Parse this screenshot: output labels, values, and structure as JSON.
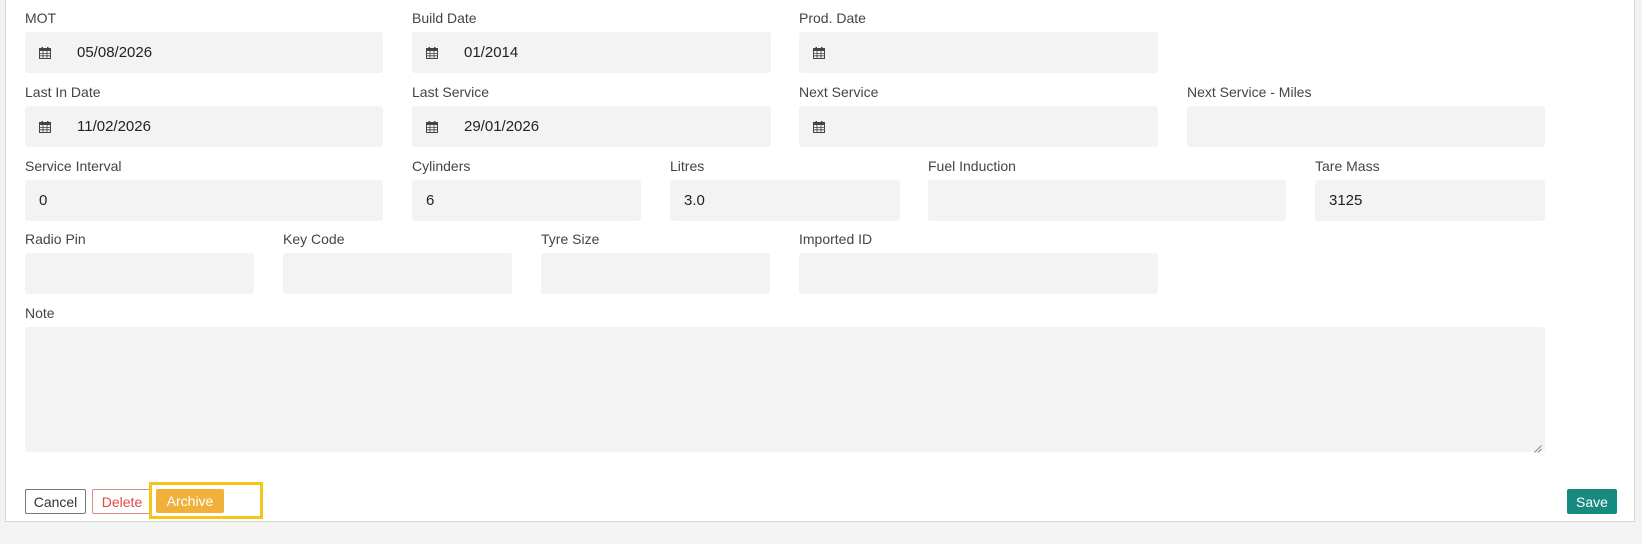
{
  "fields": {
    "mot": {
      "label": "MOT",
      "value": "05/08/2026"
    },
    "build_date": {
      "label": "Build Date",
      "value": "01/2014"
    },
    "prod_date": {
      "label": "Prod. Date",
      "value": ""
    },
    "last_in_date": {
      "label": "Last In Date",
      "value": "11/02/2026"
    },
    "last_service": {
      "label": "Last Service",
      "value": "29/01/2026"
    },
    "next_service": {
      "label": "Next Service",
      "value": ""
    },
    "next_service_miles": {
      "label": "Next Service - Miles",
      "value": ""
    },
    "service_interval": {
      "label": "Service Interval",
      "value": "0"
    },
    "cylinders": {
      "label": "Cylinders",
      "value": "6"
    },
    "litres": {
      "label": "Litres",
      "value": "3.0"
    },
    "fuel_induction": {
      "label": "Fuel Induction",
      "value": ""
    },
    "tare_mass": {
      "label": "Tare Mass",
      "value": "3125"
    },
    "radio_pin": {
      "label": "Radio Pin",
      "value": ""
    },
    "key_code": {
      "label": "Key Code",
      "value": ""
    },
    "tyre_size": {
      "label": "Tyre Size",
      "value": ""
    },
    "imported_id": {
      "label": "Imported ID",
      "value": ""
    },
    "note": {
      "label": "Note",
      "value": ""
    }
  },
  "buttons": {
    "cancel": "Cancel",
    "delete": "Delete",
    "archive": "Archive",
    "save": "Save"
  },
  "colors": {
    "archive": "#f0b03a",
    "highlight": "#f5c518",
    "save": "#178a80",
    "delete": "#e04848"
  },
  "icons": {
    "date_field": "calendar-icon"
  }
}
